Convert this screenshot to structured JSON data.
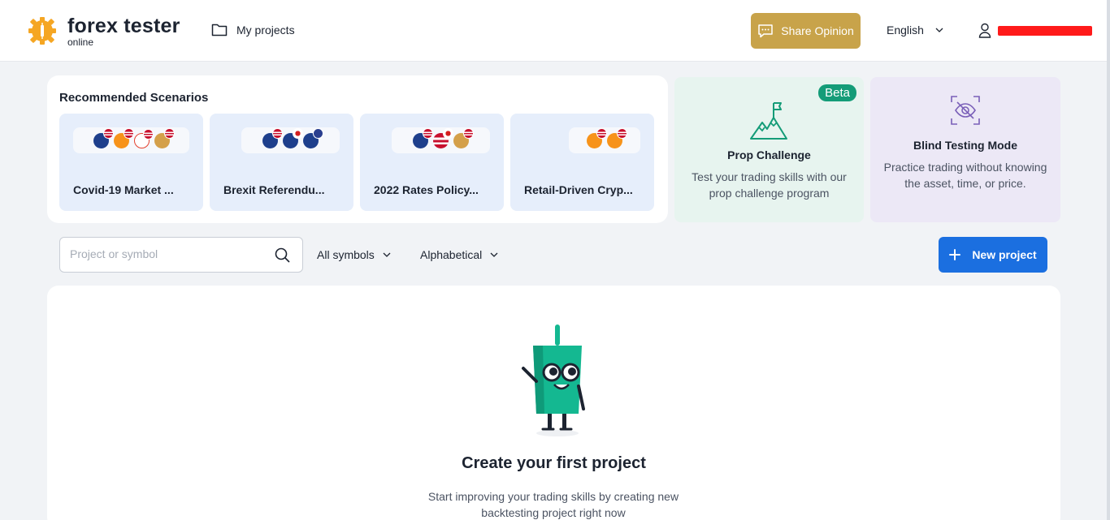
{
  "header": {
    "logo_title": "forex tester",
    "logo_subtitle": "online",
    "nav_projects": "My projects",
    "share_label": "Share Opinion",
    "language": "English",
    "user_name": "username"
  },
  "colors": {
    "accent_blue": "#1b6fe0",
    "share_gold": "#c8a34a",
    "beta_green": "#149c78",
    "logo_orange": "#f5a623"
  },
  "recommended": {
    "title": "Recommended Scenarios",
    "scenarios": [
      {
        "name": "Covid-19 Market ...",
        "flags": [
          "usd-eur",
          "usd-btc",
          "usd-500",
          "usd-au"
        ]
      },
      {
        "name": "Brexit Referendu...",
        "flags": [
          "usd-gbp",
          "jpy-gbp",
          "gbp-eur"
        ]
      },
      {
        "name": "2022 Rates Policy...",
        "flags": [
          "usd-eur",
          "jpy-usd",
          "usd-au"
        ]
      },
      {
        "name": "Retail-Driven Cryp...",
        "flags": [
          "usd-btc",
          "usd-btc"
        ]
      }
    ]
  },
  "prop": {
    "badge": "Beta",
    "title": "Prop Challenge",
    "description": "Test your trading skills with our prop challenge program",
    "icon": "mountain-flag-icon"
  },
  "blind": {
    "title": "Blind Testing Mode",
    "description": "Practice trading without knowing the asset, time, or price.",
    "icon": "eye-off-icon"
  },
  "toolbar": {
    "search_placeholder": "Project or symbol",
    "symbols_filter": "All symbols",
    "sort": "Alphabetical",
    "new_project": "New project"
  },
  "empty_state": {
    "title": "Create your first project",
    "description": "Start improving your trading skills by creating new backtesting project right now"
  }
}
